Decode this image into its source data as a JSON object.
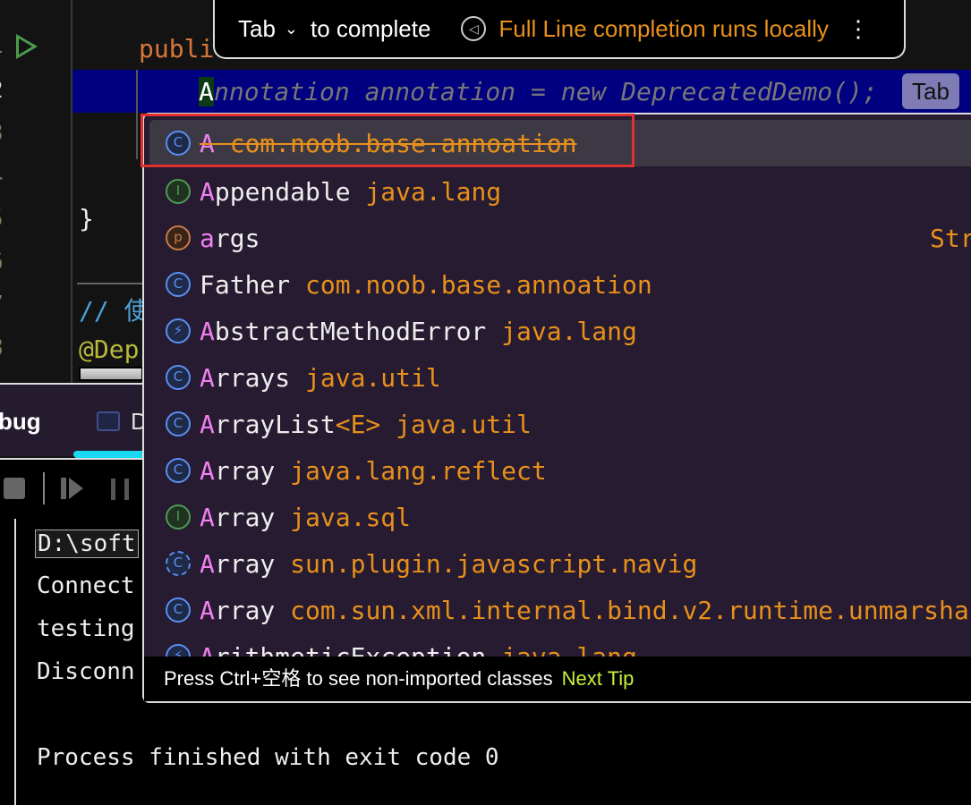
{
  "editor": {
    "line_numbers": [
      "1",
      "2",
      "3",
      "4",
      "5",
      "6",
      "7",
      "8"
    ],
    "code_public": "publi",
    "caret_char": "A",
    "inline_suggestion": "nnotation annotation = new DeprecatedDemo();",
    "brace": "}",
    "comment": "// 使",
    "annotation": "@Depr",
    "tab_badge": "Tab"
  },
  "banner": {
    "key": "Tab",
    "chevron": "⌄",
    "action": "to complete",
    "info": "Full Line completion runs locally",
    "menu": "⋮"
  },
  "completion": {
    "items": [
      {
        "icon": "C",
        "kind": "class",
        "name": "A",
        "pkg": " com.noob.base.annoation",
        "deprecated": true
      },
      {
        "icon": "I",
        "kind": "interface",
        "name": "Appendable",
        "pkg": " java.lang"
      },
      {
        "icon": "p",
        "kind": "parameter",
        "name": "args",
        "type": "Str"
      },
      {
        "icon": "C",
        "kind": "class",
        "name": "Father",
        "pkg": " com.noob.base.annoation"
      },
      {
        "icon": "⚡",
        "kind": "exception",
        "name": "AbstractMethodError",
        "pkg": " java.lang"
      },
      {
        "icon": "C",
        "kind": "class",
        "name": "Arrays",
        "pkg": " java.util"
      },
      {
        "icon": "C",
        "kind": "class",
        "name": "ArrayList",
        "generic": "<E>",
        "pkg": " java.util"
      },
      {
        "icon": "C",
        "kind": "class",
        "name": "Array",
        "pkg": " java.lang.reflect"
      },
      {
        "icon": "I",
        "kind": "interface",
        "name": "Array",
        "pkg": " java.sql"
      },
      {
        "icon": "C",
        "kind": "class",
        "name": "Array",
        "pkg": " sun.plugin.javascript.navig"
      },
      {
        "icon": "C",
        "kind": "class",
        "name": "Array",
        "pkg": " com.sun.xml.internal.bind.v2.runtime.unmarsha"
      },
      {
        "icon": "⚡",
        "kind": "exception",
        "name": "ArithmeticException",
        "pkg": " java.lang"
      }
    ],
    "footer": "Press Ctrl+空格 to see non-imported classes",
    "footer_link": "Next Tip"
  },
  "panel": {
    "title": "bug",
    "tab": "D"
  },
  "console": {
    "lines": [
      "D:\\soft",
      "Connect",
      "testing",
      "Disconn",
      "",
      "Process finished with exit code 0"
    ]
  },
  "colors": {
    "highlight": "#000080",
    "popup": "#261b30",
    "package": "#e8901c",
    "match": "#f07ff0",
    "selection_box": "#e03030",
    "tab_underline": "#1ad9f0"
  }
}
